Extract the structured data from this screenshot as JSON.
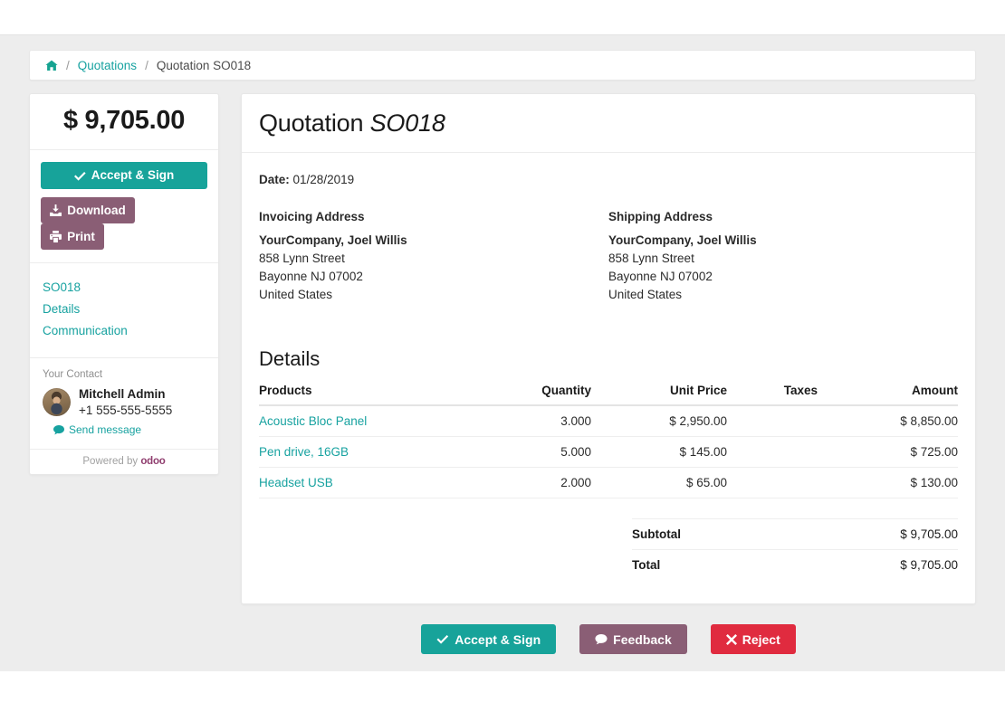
{
  "breadcrumb": {
    "home_icon": "home-icon",
    "separator": "/",
    "link": "Quotations",
    "current": "Quotation SO018"
  },
  "sidebar": {
    "amount": "$ 9,705.00",
    "accept_label": "Accept & Sign",
    "download_label": "Download",
    "print_label": "Print",
    "nav": [
      {
        "label": "SO018"
      },
      {
        "label": "Details"
      },
      {
        "label": "Communication"
      }
    ],
    "contact": {
      "heading": "Your Contact",
      "name": "Mitchell Admin",
      "phone": "+1 555-555-5555",
      "send_message": "Send message"
    },
    "powered_prefix": "Powered by",
    "powered_brand": "odoo"
  },
  "document": {
    "title_prefix": "Quotation",
    "title_number": "SO018",
    "date_label": "Date:",
    "date_value": "01/28/2019",
    "invoicing": {
      "heading": "Invoicing Address",
      "company": "YourCompany, Joel Willis",
      "street": "858 Lynn Street",
      "city": "Bayonne NJ 07002",
      "country": "United States"
    },
    "shipping": {
      "heading": "Shipping Address",
      "company": "YourCompany, Joel Willis",
      "street": "858 Lynn Street",
      "city": "Bayonne NJ 07002",
      "country": "United States"
    },
    "details_heading": "Details",
    "table": {
      "headers": {
        "products": "Products",
        "quantity": "Quantity",
        "unit_price": "Unit Price",
        "taxes": "Taxes",
        "amount": "Amount"
      },
      "rows": [
        {
          "product": "Acoustic Bloc Panel",
          "quantity": "3.000",
          "unit_price": "$ 2,950.00",
          "taxes": "",
          "amount": "$ 8,850.00"
        },
        {
          "product": "Pen drive, 16GB",
          "quantity": "5.000",
          "unit_price": "$ 145.00",
          "taxes": "",
          "amount": "$ 725.00"
        },
        {
          "product": "Headset USB",
          "quantity": "2.000",
          "unit_price": "$ 65.00",
          "taxes": "",
          "amount": "$ 130.00"
        }
      ]
    },
    "totals": {
      "subtotal_label": "Subtotal",
      "subtotal_value": "$ 9,705.00",
      "total_label": "Total",
      "total_value": "$ 9,705.00"
    }
  },
  "bottom_actions": {
    "accept_label": "Accept & Sign",
    "feedback_label": "Feedback",
    "reject_label": "Reject"
  },
  "colors": {
    "teal": "#17a39a",
    "link_teal": "#17a2a0",
    "purple": "#8a5e75",
    "red": "#e02b3f",
    "odoo_purple": "#8f3d6e",
    "page_bg": "#ededed"
  }
}
